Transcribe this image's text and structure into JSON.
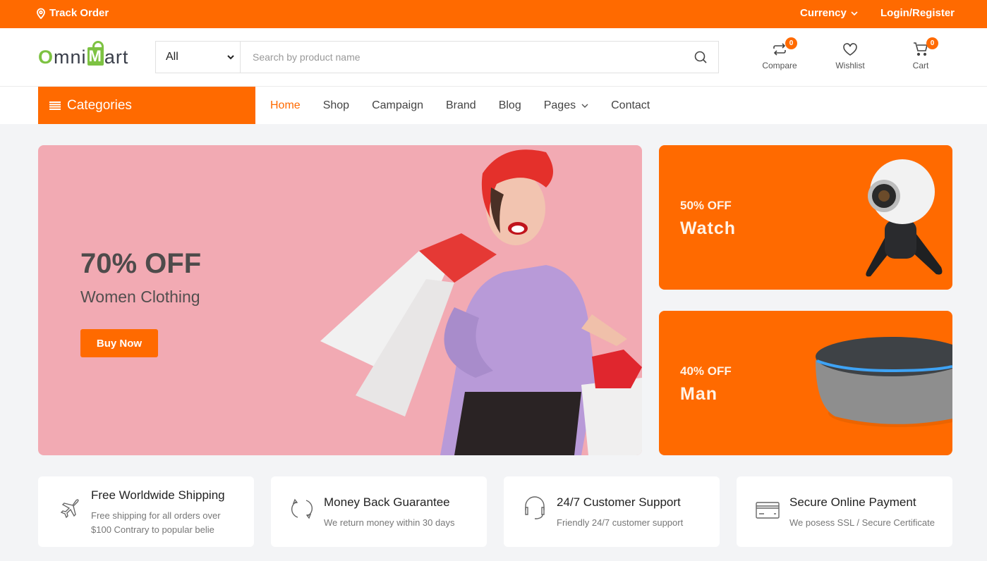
{
  "topbar": {
    "track_order": "Track Order",
    "currency": "Currency",
    "login_register": "Login/Register"
  },
  "header": {
    "logo": {
      "o": "O",
      "mni": "mni",
      "m": "M",
      "art": "art"
    },
    "search": {
      "category_selected": "All",
      "placeholder": "Search by product name",
      "value": ""
    },
    "compare": {
      "label": "Compare",
      "count": "0"
    },
    "wishlist": {
      "label": "Wishlist"
    },
    "cart": {
      "label": "Cart",
      "count": "0"
    }
  },
  "nav": {
    "categories_label": "Categories",
    "items": [
      {
        "label": "Home",
        "active": true
      },
      {
        "label": "Shop"
      },
      {
        "label": "Campaign"
      },
      {
        "label": "Brand"
      },
      {
        "label": "Blog"
      },
      {
        "label": "Pages",
        "has_dropdown": true
      },
      {
        "label": "Contact"
      }
    ]
  },
  "hero": {
    "title": "70% OFF",
    "subtitle": "Women Clothing",
    "button": "Buy Now",
    "background": "#f2aab3"
  },
  "promos": [
    {
      "discount": "50% OFF",
      "name": "Watch",
      "image": "360-camera-on-tripod"
    },
    {
      "discount": "40% OFF",
      "name": "Man",
      "image": "smart-speaker"
    }
  ],
  "features": [
    {
      "icon": "airplane-icon",
      "title": "Free Worldwide Shipping",
      "desc": "Free shipping for all orders over $100 Contrary to popular belie"
    },
    {
      "icon": "refresh-icon",
      "title": "Money Back Guarantee",
      "desc": "We return money within 30 days"
    },
    {
      "icon": "headset-icon",
      "title": "24/7 Customer Support",
      "desc": "Friendly 24/7 customer support"
    },
    {
      "icon": "credit-card-icon",
      "title": "Secure Online Payment",
      "desc": "We posess SSL / Secure Certificate"
    }
  ],
  "colors": {
    "accent": "#ff6a00",
    "logo_green": "#7dc242",
    "page_bg": "#f3f4f6"
  }
}
